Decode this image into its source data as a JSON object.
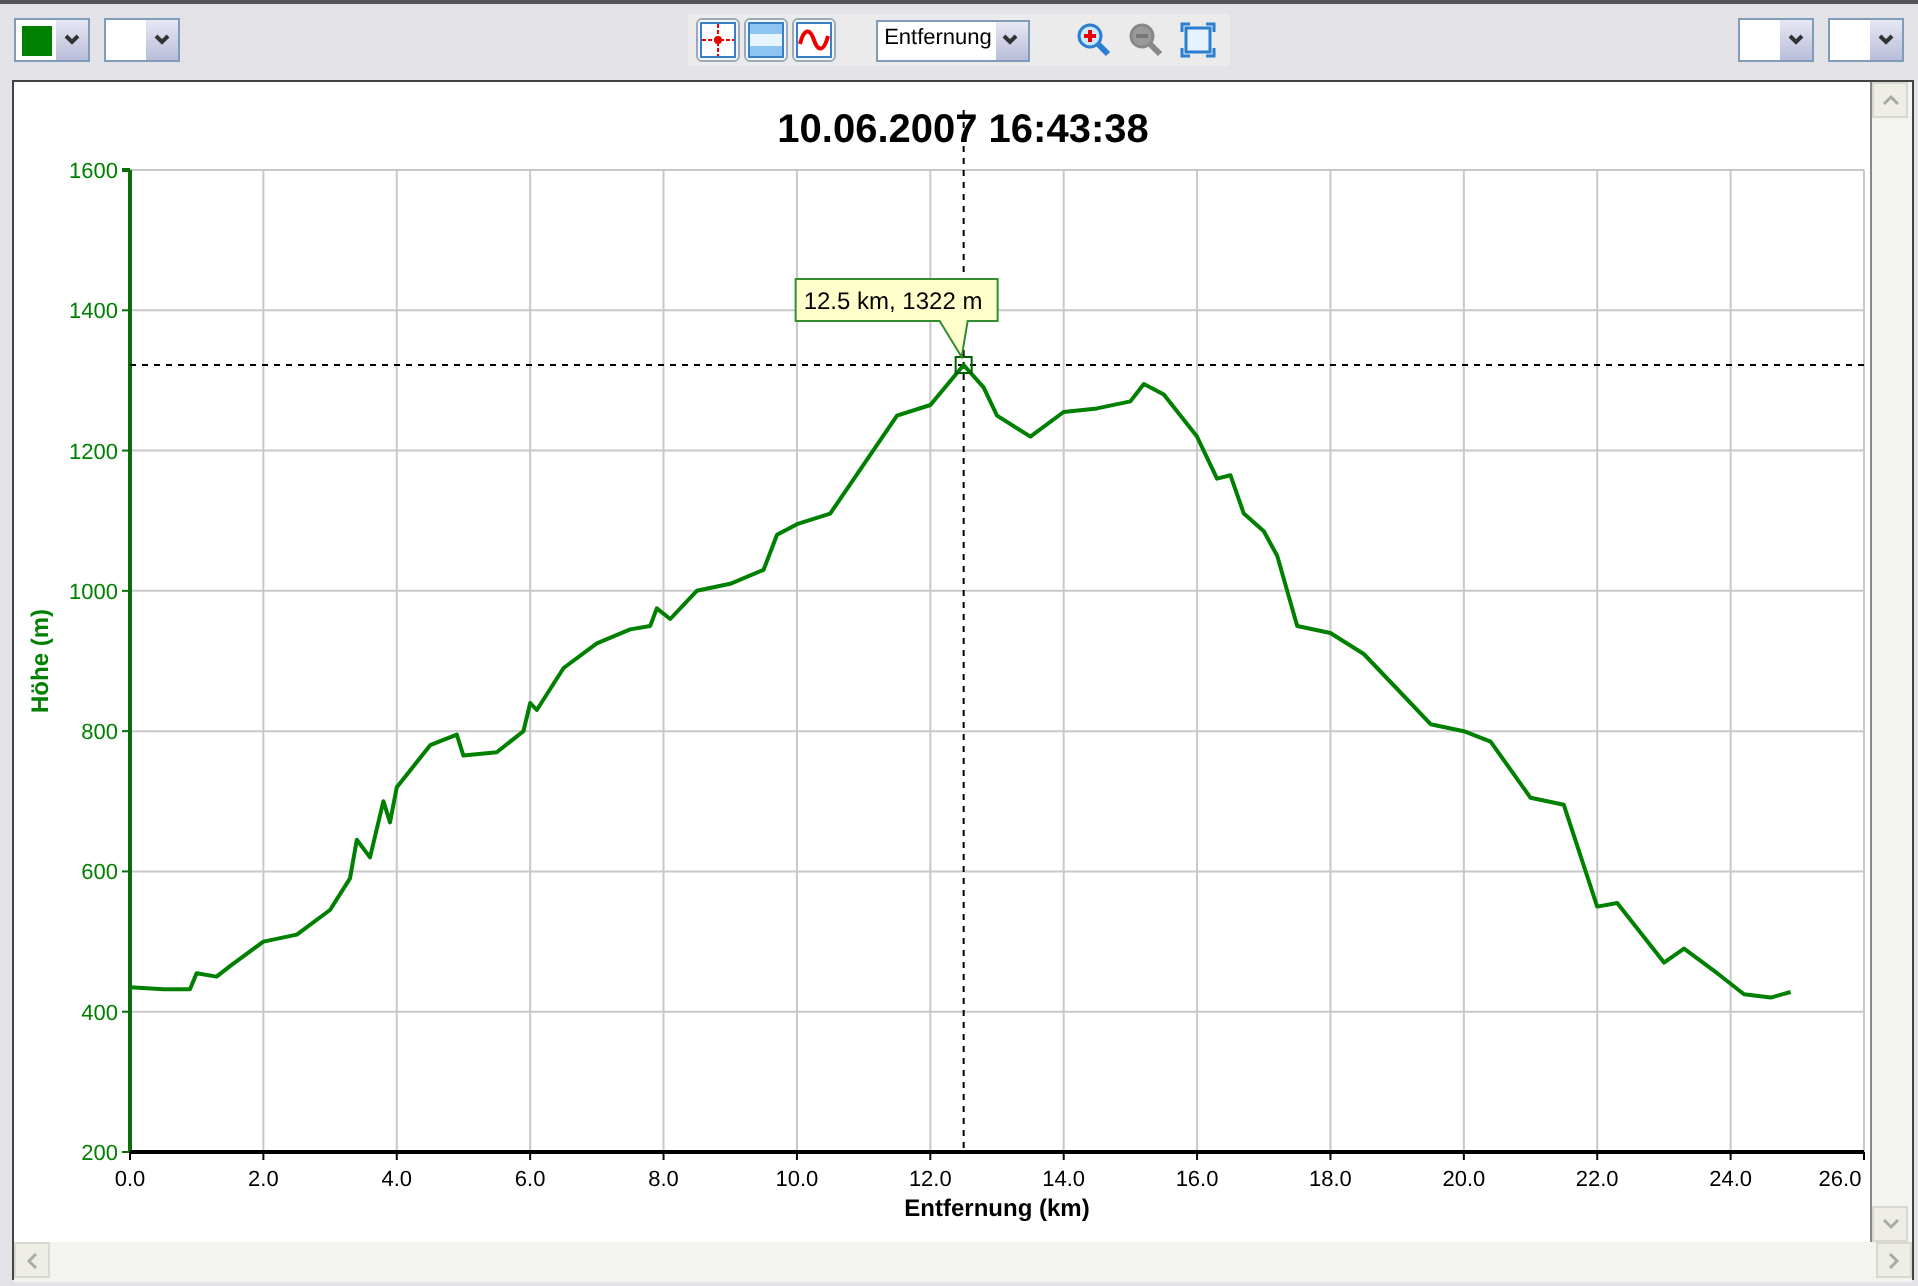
{
  "toolbar": {
    "line_color": {
      "color": "#008000"
    },
    "tool_buttons": [
      {
        "kind": "crosshair"
      },
      {
        "kind": "bands"
      },
      {
        "kind": "curve"
      }
    ],
    "axis_select": {
      "value": "Entfernung"
    },
    "zoom_buttons": [
      {
        "kind": "zoom_in",
        "disabled": false
      },
      {
        "kind": "zoom_out",
        "disabled": true
      },
      {
        "kind": "fit",
        "disabled": false
      }
    ]
  },
  "chart": {
    "chart_data": {
      "type": "line",
      "title": "10.06.2007 16:43:38",
      "xlabel": "Entfernung (km)",
      "ylabel": "Höhe (m)",
      "x": [
        0,
        0.5,
        0.9,
        1.0,
        1.3,
        1.5,
        2.0,
        2.5,
        3.0,
        3.3,
        3.4,
        3.6,
        3.8,
        3.9,
        4.0,
        4.5,
        4.9,
        5.0,
        5.5,
        5.9,
        6.0,
        6.1,
        6.5,
        7.0,
        7.5,
        7.8,
        7.9,
        8.1,
        8.5,
        9.0,
        9.5,
        9.7,
        10.0,
        10.5,
        11.0,
        11.5,
        12.0,
        12.5,
        12.8,
        13.0,
        13.5,
        14.0,
        14.5,
        15.0,
        15.2,
        15.5,
        16.0,
        16.3,
        16.5,
        16.7,
        17.0,
        17.2,
        17.5,
        18.0,
        18.5,
        19.0,
        19.5,
        20.0,
        20.4,
        21.0,
        21.5,
        22.0,
        22.3,
        23.0,
        23.3,
        23.8,
        24.2,
        24.6,
        24.9
      ],
      "series": [
        {
          "color": "#008000",
          "values": [
            435,
            432,
            432,
            455,
            450,
            465,
            500,
            510,
            545,
            590,
            645,
            620,
            700,
            670,
            720,
            780,
            795,
            765,
            770,
            800,
            840,
            830,
            890,
            925,
            945,
            950,
            975,
            960,
            1000,
            1010,
            1030,
            1080,
            1095,
            1110,
            1180,
            1250,
            1265,
            1322,
            1290,
            1250,
            1220,
            1255,
            1260,
            1270,
            1295,
            1280,
            1220,
            1160,
            1165,
            1110,
            1085,
            1050,
            950,
            940,
            910,
            860,
            810,
            800,
            785,
            705,
            695,
            550,
            555,
            470,
            490,
            455,
            425,
            420,
            428
          ]
        }
      ],
      "grid": true,
      "ref_lines": [
        {
          "axis": "x",
          "value": 12.5
        },
        {
          "axis": "y",
          "value": 1322
        }
      ],
      "xlim": [
        0,
        26
      ],
      "ylim": [
        200,
        1600
      ],
      "xticks": [
        {
          "value": 0,
          "label": "0.0"
        },
        {
          "value": 2,
          "label": "2.0"
        },
        {
          "value": 4,
          "label": "4.0"
        },
        {
          "value": 6,
          "label": "6.0"
        },
        {
          "value": 8,
          "label": "8.0"
        },
        {
          "value": 10,
          "label": "10.0"
        },
        {
          "value": 12,
          "label": "12.0"
        },
        {
          "value": 14,
          "label": "14.0"
        },
        {
          "value": 16,
          "label": "16.0"
        },
        {
          "value": 18,
          "label": "18.0"
        },
        {
          "value": 20,
          "label": "20.0"
        },
        {
          "value": 22,
          "label": "22.0"
        },
        {
          "value": 24,
          "label": "24.0"
        },
        {
          "value": 26,
          "label": "26.0"
        }
      ],
      "yticks": [
        200,
        400,
        600,
        800,
        1000,
        1200,
        1400,
        1600
      ],
      "annotations": [
        {
          "x": 12.5,
          "y": 1322,
          "text": "12.5 km, 1322 m"
        }
      ]
    }
  }
}
